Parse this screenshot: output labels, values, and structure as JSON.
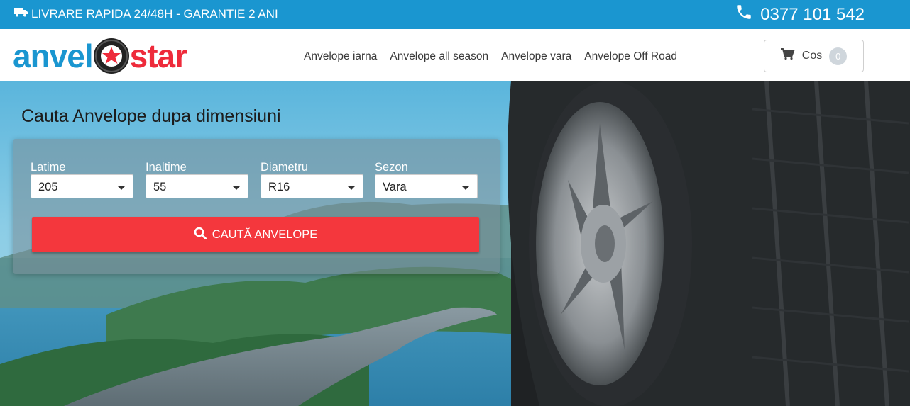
{
  "topbar": {
    "delivery_text": "LIVRARE RAPIDA 24/48H - GARANTIE 2 ANI",
    "delivery_icon": "truck-icon",
    "phone": "0377 101 542",
    "phone_icon": "phone-icon",
    "bg_color": "#1a96d0"
  },
  "logo": {
    "part1": "anvel",
    "part2": "star",
    "color_blue": "#1a96d0",
    "color_red": "#ee2b3b"
  },
  "nav": {
    "items": [
      {
        "label": "Anvelope iarna"
      },
      {
        "label": "Anvelope all season"
      },
      {
        "label": "Anvelope vara"
      },
      {
        "label": "Anvelope Off Road"
      }
    ]
  },
  "cart": {
    "label": "Cos",
    "count": "0",
    "icon": "cart-icon"
  },
  "hero": {
    "title": "Cauta Anvelope dupa dimensiuni"
  },
  "search": {
    "fields": [
      {
        "label": "Latime",
        "value": "205"
      },
      {
        "label": "Inaltime",
        "value": "55"
      },
      {
        "label": "Diametru",
        "value": "R16"
      },
      {
        "label": "Sezon",
        "value": "Vara"
      }
    ],
    "button_label": "CAUTĂ ANVELOPE",
    "button_color": "#f4373d"
  }
}
